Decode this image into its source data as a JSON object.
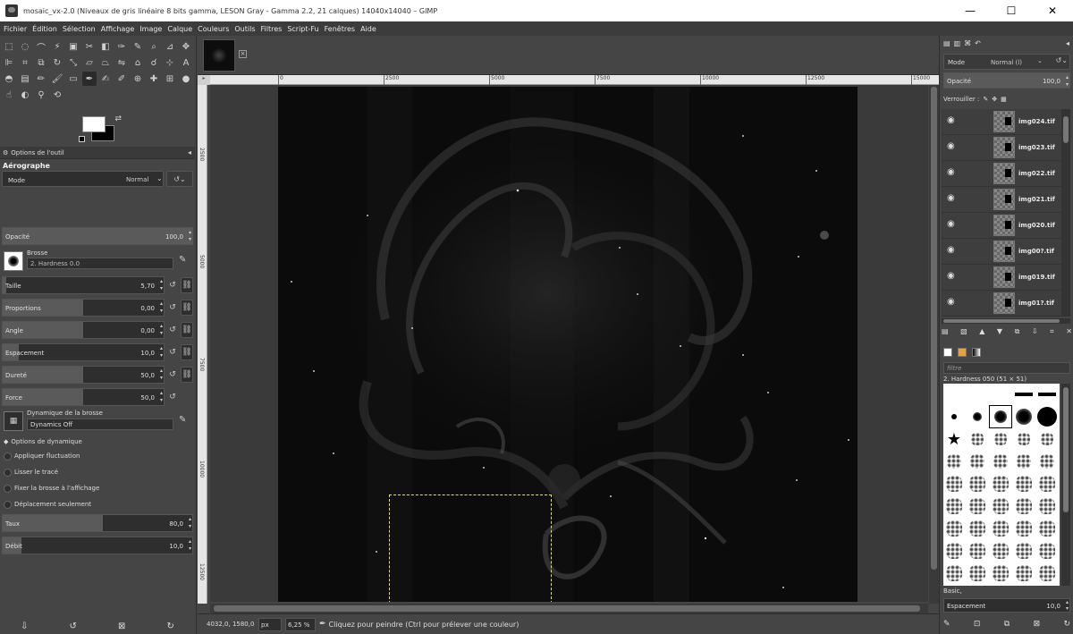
{
  "window": {
    "title": "mosaic_vx-2.0 (Niveaux de gris linéaire 8 bits gamma, LESON Gray - Gamma 2.2, 21 calques) 14040x14040 – GIMP",
    "minimize": "—",
    "maximize": "☐",
    "close": "✕"
  },
  "menu": [
    "Fichier",
    "Édition",
    "Sélection",
    "Affichage",
    "Image",
    "Calque",
    "Couleurs",
    "Outils",
    "Filtres",
    "Script-Fu",
    "Fenêtres",
    "Aide"
  ],
  "toolbox": {
    "tools": [
      {
        "name": "rect-select-icon",
        "glyph": "⬚"
      },
      {
        "name": "ellipse-select-icon",
        "glyph": "◌"
      },
      {
        "name": "free-select-icon",
        "glyph": "⌒"
      },
      {
        "name": "fuzzy-select-icon",
        "glyph": "⚡"
      },
      {
        "name": "select-by-color-icon",
        "glyph": "▣"
      },
      {
        "name": "scissors-icon",
        "glyph": "✂"
      },
      {
        "name": "foreground-select-icon",
        "glyph": "◧"
      },
      {
        "name": "paths-icon",
        "glyph": "✑"
      },
      {
        "name": "color-picker-icon",
        "glyph": "✎"
      },
      {
        "name": "zoom-icon",
        "glyph": "⌕"
      },
      {
        "name": "measure-icon",
        "glyph": "⊿"
      },
      {
        "name": "move-icon",
        "glyph": "✥"
      },
      {
        "name": "align-icon",
        "glyph": "⊫"
      },
      {
        "name": "crop-icon",
        "glyph": "⌗"
      },
      {
        "name": "unified-transform-icon",
        "glyph": "⧉"
      },
      {
        "name": "rotate-icon",
        "glyph": "↻"
      },
      {
        "name": "scale-icon",
        "glyph": "⤡"
      },
      {
        "name": "shear-icon",
        "glyph": "▱"
      },
      {
        "name": "perspective-icon",
        "glyph": "⏢"
      },
      {
        "name": "flip-icon",
        "glyph": "⇋"
      },
      {
        "name": "cage-icon",
        "glyph": "⌂"
      },
      {
        "name": "warp-icon",
        "glyph": "☌"
      },
      {
        "name": "handle-transform-icon",
        "glyph": "⊹"
      },
      {
        "name": "text-icon",
        "glyph": "A"
      },
      {
        "name": "bucket-fill-icon",
        "glyph": "◓"
      },
      {
        "name": "gradient-icon",
        "glyph": "▤"
      },
      {
        "name": "pencil-icon",
        "glyph": "✏"
      },
      {
        "name": "paintbrush-icon",
        "glyph": "🖌"
      },
      {
        "name": "eraser-icon",
        "glyph": "▭"
      },
      {
        "name": "airbrush-icon",
        "glyph": "✒",
        "active": true
      },
      {
        "name": "ink-icon",
        "glyph": "✍"
      },
      {
        "name": "mypaint-brush-icon",
        "glyph": "✐"
      },
      {
        "name": "clone-icon",
        "glyph": "⊕"
      },
      {
        "name": "heal-icon",
        "glyph": "✚"
      },
      {
        "name": "perspective-clone-icon",
        "glyph": "⊞"
      },
      {
        "name": "blur-icon",
        "glyph": "●"
      },
      {
        "name": "smudge-icon",
        "glyph": "☝"
      },
      {
        "name": "dodge-burn-icon",
        "glyph": "◐"
      },
      {
        "name": "color-sample-icon",
        "glyph": "⚲"
      },
      {
        "name": "warp-transform-icon",
        "glyph": "⟲"
      }
    ],
    "swap_glyph": "⇄",
    "options_tab_label": "Options de l'outil",
    "tool_name": "Aérographe",
    "mode_label": "Mode",
    "mode_value": "Normal",
    "brush_label": "Brosse",
    "brush_name": "2. Hardness 0.0",
    "dynamics_label": "Dynamique de la brosse",
    "dynamics_name": "Dynamics Off",
    "sliders": [
      {
        "label": "Taille",
        "value": "5,70",
        "fill": 0.02
      },
      {
        "label": "Proportions",
        "value": "0,00",
        "fill": 0.5
      },
      {
        "label": "Angle",
        "value": "0,00",
        "fill": 0.5
      },
      {
        "label": "Espacement",
        "value": "10,0",
        "fill": 0.1
      },
      {
        "label": "Dureté",
        "value": "50,0",
        "fill": 0.5
      },
      {
        "label": "Force",
        "value": "50,0",
        "fill": 0.5
      }
    ],
    "dynamics_options_label": "Options de dynamique",
    "checkboxes": [
      "Appliquer fluctuation",
      "Lisser le tracé",
      "Fixer la brosse à l'affichage",
      "Déplacement seulement"
    ],
    "rate": {
      "label": "Taux",
      "value": "80,0",
      "fill": 0.53
    },
    "flow": {
      "label": "Débit",
      "value": "10,0",
      "fill": 0.1
    },
    "bottom_glyphs": [
      "⇩",
      "↺",
      "⊠",
      "↻"
    ]
  },
  "canvas": {
    "ruler_top_ticks": [
      "0",
      "2500",
      "5000",
      "7500",
      "10000",
      "12500",
      "15000"
    ],
    "ruler_left_ticks": [
      "2500",
      "5000",
      "7500",
      "10000",
      "12500"
    ]
  },
  "status": {
    "coords": "4032,0, 1580,0",
    "unit": "px",
    "zoom": "6,25 %",
    "message": "Cliquez pour peindre (Ctrl pour prélever une couleur)"
  },
  "layers_panel": {
    "mode_label": "Mode",
    "mode_value": "Normal (l)",
    "opacity_label": "Opacité",
    "opacity_value": "100,0",
    "lock_label": "Verrouiller :",
    "layers": [
      "img024.tif",
      "img023.tif",
      "img022.tif",
      "img021.tif",
      "img020.tif",
      "img00?.tif",
      "img019.tif",
      "img01?.tif"
    ],
    "action_glyphs": [
      "▤",
      "▧",
      "▲",
      "▼",
      "⧉",
      "⇩",
      "⌗",
      "✕"
    ]
  },
  "brushes_panel": {
    "filter_placeholder": "filtre",
    "selected": "2. Hardness 050 (51 × 51)",
    "set_label": "Basic,",
    "spacing_label": "Espacement",
    "spacing_value": "10,0",
    "bottom_glyphs": [
      "✎",
      "⊡",
      "⧉",
      "⊠",
      "↻"
    ]
  }
}
